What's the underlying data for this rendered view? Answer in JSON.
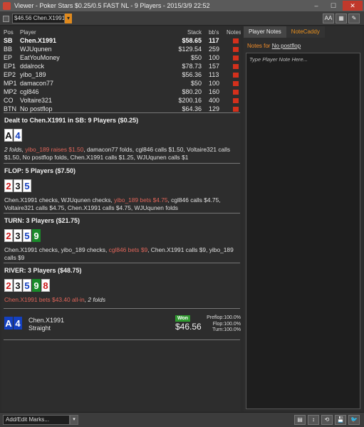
{
  "window": {
    "title": "Viewer - Poker Stars $0.25/0.5 FAST NL - 9 Players - 2015/3/9 22:52",
    "minimize": "–",
    "maximize": "☐",
    "close": "✕"
  },
  "toolbar": {
    "hand_selector": "$46.56 Chen.X1991",
    "dropdown_arrow": "▾",
    "icons": [
      "AA",
      "▦",
      "✎"
    ]
  },
  "players": {
    "headers": {
      "pos": "Pos",
      "player": "Player",
      "stack": "Stack",
      "bbs": "bb's",
      "notes": "Notes"
    },
    "rows": [
      {
        "pos": "SB",
        "name": "Chen.X1991",
        "stack": "$58.65",
        "bbs": "117",
        "hero": true
      },
      {
        "pos": "BB",
        "name": "WJUqunen",
        "stack": "$129.54",
        "bbs": "259"
      },
      {
        "pos": "EP",
        "name": "EatYouMoney",
        "stack": "$50",
        "bbs": "100"
      },
      {
        "pos": "EP1",
        "name": "ddalrock",
        "stack": "$78.73",
        "bbs": "157"
      },
      {
        "pos": "EP2",
        "name": "yibo_189",
        "stack": "$56.36",
        "bbs": "113"
      },
      {
        "pos": "MP1",
        "name": "damacon77",
        "stack": "$50",
        "bbs": "100"
      },
      {
        "pos": "MP2",
        "name": "cgl846",
        "stack": "$80.20",
        "bbs": "160"
      },
      {
        "pos": "CO",
        "name": "Voltaire321",
        "stack": "$200.16",
        "bbs": "400"
      },
      {
        "pos": "BTN",
        "name": "No postflop",
        "stack": "$64.36",
        "bbs": "129"
      }
    ]
  },
  "preflop": {
    "title": "Dealt to Chen.X1991 in SB: 9 Players ($0.25)",
    "cards": [
      {
        "r": "A",
        "suit": "spade"
      },
      {
        "r": "4",
        "suit": "diamond"
      }
    ],
    "a1": "2 folds, ",
    "a2": "yibo_189 raises $1.50",
    "a3": ", damacon77 folds, cgl846 calls $1.50, Voltaire321 calls $1.50, No postflop folds, Chen.X1991 calls $1.25, WJUqunen calls $1"
  },
  "flop": {
    "title": "FLOP: 5 Players ($7.50)",
    "cards": [
      {
        "r": "2",
        "suit": "heart"
      },
      {
        "r": "3",
        "suit": "spade"
      },
      {
        "r": "5",
        "suit": "diamond"
      }
    ],
    "a1": "Chen.X1991 checks, WJUqunen checks, ",
    "a2": "yibo_189 bets $4.75",
    "a3": ", cgl846 calls $4.75, Voltaire321 calls $4.75, Chen.X1991 calls $4.75, WJUqunen folds"
  },
  "turn": {
    "title": "TURN: 3 Players ($21.75)",
    "cards": [
      {
        "r": "2",
        "suit": "heart"
      },
      {
        "r": "3",
        "suit": "spade"
      },
      {
        "r": "5",
        "suit": "diamond"
      },
      {
        "r": "9",
        "suit": "club-fill"
      }
    ],
    "a1": "Chen.X1991 checks, yibo_189 checks, ",
    "a2": "cgl846 bets $9",
    "a3": ", Chen.X1991 calls $9, yibo_189 calls $9"
  },
  "river": {
    "title": "RIVER: 3 Players ($48.75)",
    "cards": [
      {
        "r": "2",
        "suit": "heart"
      },
      {
        "r": "3",
        "suit": "spade"
      },
      {
        "r": "5",
        "suit": "diamond"
      },
      {
        "r": "9",
        "suit": "club-fill"
      },
      {
        "r": "8",
        "suit": "heart"
      }
    ],
    "a2": "Chen.X1991 bets $43.40 all-in",
    "a3": ", 2 folds"
  },
  "result": {
    "cards": [
      {
        "r": "A",
        "suit": "dia-fill"
      },
      {
        "r": "4",
        "suit": "dia-fill"
      }
    ],
    "name": "Chen.X1991",
    "hand": "Straight",
    "won_label": "Won",
    "amount": "$46.56",
    "equity": [
      {
        "label": "Preflop:",
        "val": "100.0%"
      },
      {
        "label": "Flop:",
        "val": "100.0%"
      },
      {
        "label": "Turn:",
        "val": "100.0%"
      }
    ]
  },
  "notes_panel": {
    "tab_notes": "Player Notes",
    "tab_caddy": "NoteCaddy",
    "notes_for": "Notes for ",
    "notes_for_player": "No postflop",
    "placeholder": "Type Player Note Here..."
  },
  "bottom": {
    "marks": "Add/Edit Marks...",
    "marks_arrow": "▾",
    "icons": [
      "▤",
      "↕",
      "⟲",
      "💾",
      "🐦"
    ]
  }
}
